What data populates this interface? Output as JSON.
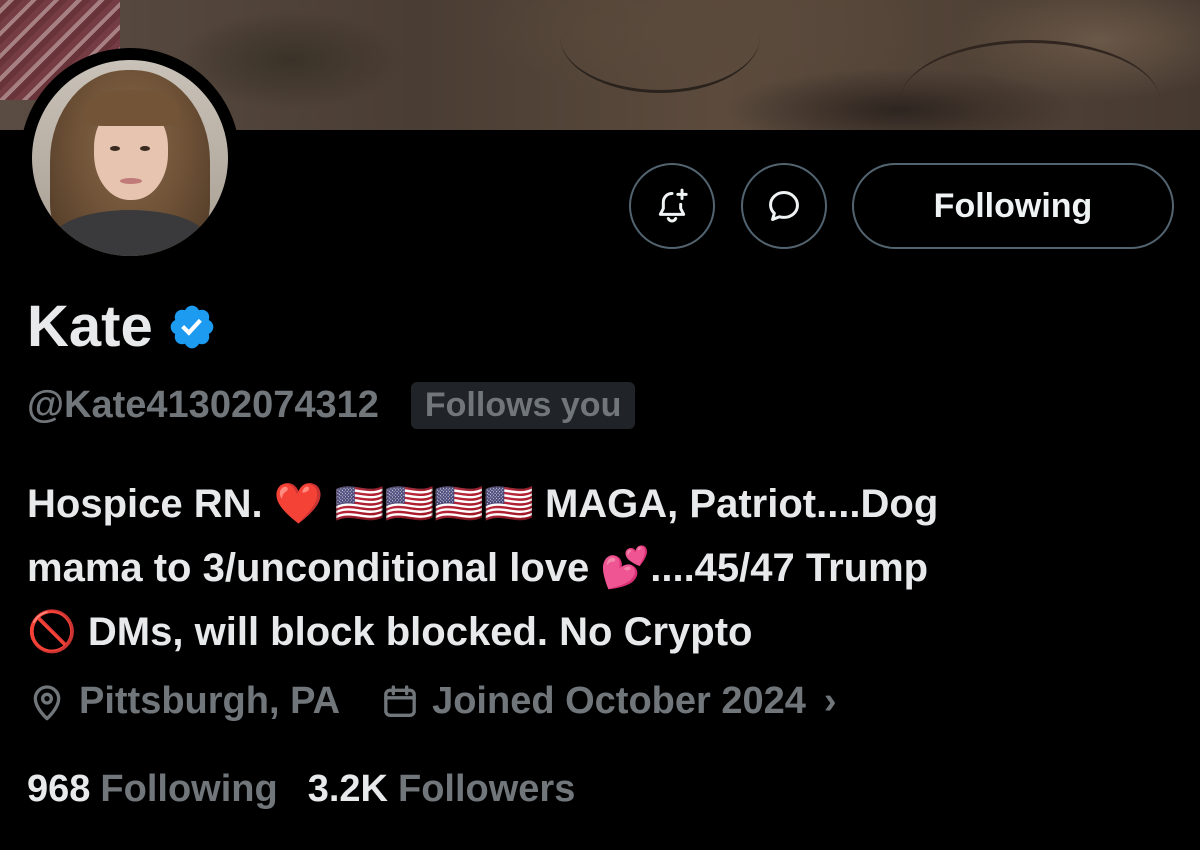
{
  "profile": {
    "name": "Kate",
    "handle": "@Kate41302074312",
    "follows_you": "Follows you",
    "verified_icon": "verified-badge-icon",
    "bio_lines": [
      "Hospice RN. ❤️ 🇺🇸🇺🇸🇺🇸🇺🇸 MAGA, Patriot....Dog",
      "mama to 3/unconditional love 💕....45/47 Trump",
      "🚫 DMs, will block blocked. No Crypto"
    ],
    "location": "Pittsburgh, PA",
    "joined": "Joined October 2024",
    "following_count": "968",
    "following_label": "Following",
    "followers_count": "3.2K",
    "followers_label": "Followers"
  },
  "actions": {
    "notify_icon": "bell-plus-icon",
    "message_icon": "message-bubble-icon",
    "following_button": "Following"
  },
  "colors": {
    "background": "#000000",
    "primary_text": "#e7e9ea",
    "secondary_text": "#71767b",
    "border": "#536471",
    "verified_blue": "#1d9bf0"
  }
}
